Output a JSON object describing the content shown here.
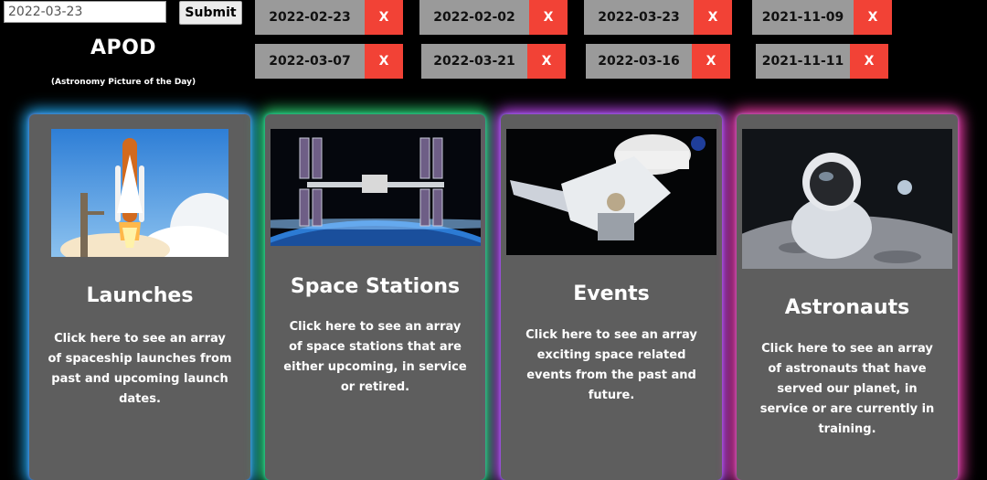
{
  "form": {
    "date_value": "2022-03-23",
    "submit_label": "Submit"
  },
  "header": {
    "title": "APOD",
    "subtitle": "(Astronomy Picture of the Day)"
  },
  "saved_dates": [
    {
      "date": "2022-02-23",
      "remove_label": "X"
    },
    {
      "date": "2022-02-02",
      "remove_label": "X"
    },
    {
      "date": "2022-03-23",
      "remove_label": "X"
    },
    {
      "date": "2021-11-09",
      "remove_label": "X"
    },
    {
      "date": "2022-03-07",
      "remove_label": "X"
    },
    {
      "date": "2022-03-21",
      "remove_label": "X"
    },
    {
      "date": "2022-03-16",
      "remove_label": "X"
    },
    {
      "date": "2021-11-11",
      "remove_label": "X"
    }
  ],
  "cards": [
    {
      "title": "Launches",
      "description": "Click here to see an array of spaceship launches from past and upcoming launch dates.",
      "image": "space-shuttle-launch",
      "glow": "#23b3ff"
    },
    {
      "title": "Space Stations",
      "description": "Click here to see an array of space stations that are either upcoming, in service or retired.",
      "image": "space-station-orbit",
      "glow": "#2ee07a"
    },
    {
      "title": "Events",
      "description": "Click here to see an array exciting space related events from the past and future.",
      "image": "spacecraft-docking",
      "glow": "#c94bff"
    },
    {
      "title": "Astronauts",
      "description": "Click here to see an array of astronauts that have served our planet, in service or are currently in training.",
      "image": "astronaut-on-moon",
      "glow": "#ff3fb4"
    }
  ],
  "colors": {
    "chip_bg": "#9a9a9a",
    "remove_bg": "#f24236",
    "card_bg": "#5e5e5e",
    "page_bg": "#000000"
  }
}
